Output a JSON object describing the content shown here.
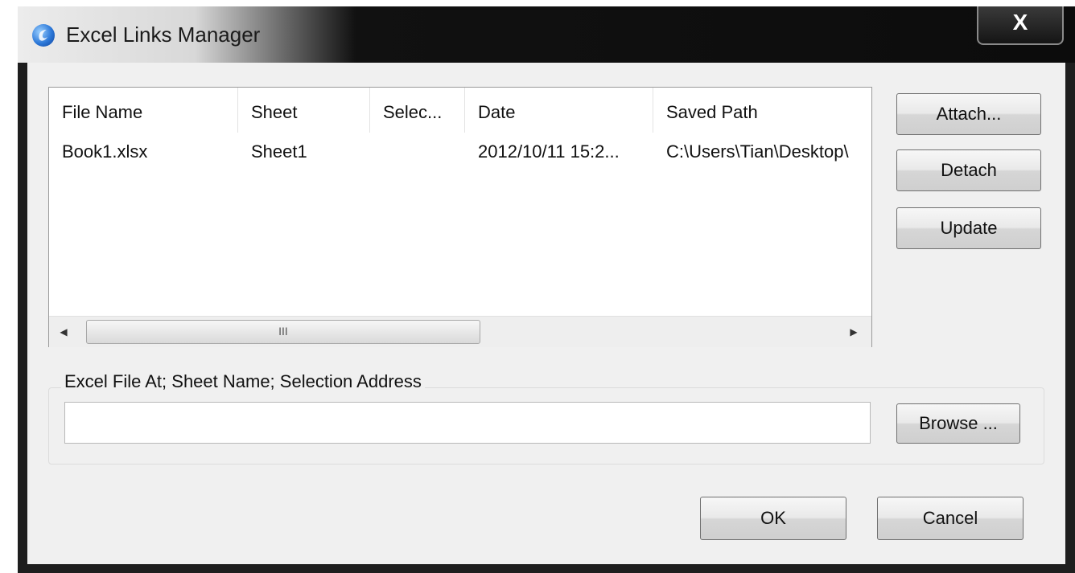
{
  "window": {
    "title": "Excel Links Manager",
    "close_glyph": "X"
  },
  "list": {
    "columns": [
      "File Name",
      "Sheet",
      "Selec...",
      "Date",
      "Saved Path"
    ],
    "rows": [
      [
        "Book1.xlsx",
        "Sheet1",
        "",
        "2012/10/11 15:2...",
        "C:\\Users\\Tian\\Desktop\\"
      ]
    ],
    "scroll_left_glyph": "◀",
    "scroll_right_glyph": "▶",
    "thumb_grip": "III"
  },
  "side_buttons": {
    "attach": "Attach...",
    "detach": "Detach",
    "update": "Update"
  },
  "excel_file": {
    "group_label": "Excel File At; Sheet Name; Selection Address",
    "value": "",
    "browse_label": "Browse ..."
  },
  "footer": {
    "ok_label": "OK",
    "cancel_label": "Cancel"
  },
  "icons": {
    "app": "app-logo-icon",
    "close": "close-icon",
    "scroll_left": "arrow-left-icon",
    "scroll_right": "arrow-right-icon"
  },
  "colors": {
    "accent": "#2c78d8",
    "titlebar": "#111111",
    "client": "#f0f0f0"
  }
}
